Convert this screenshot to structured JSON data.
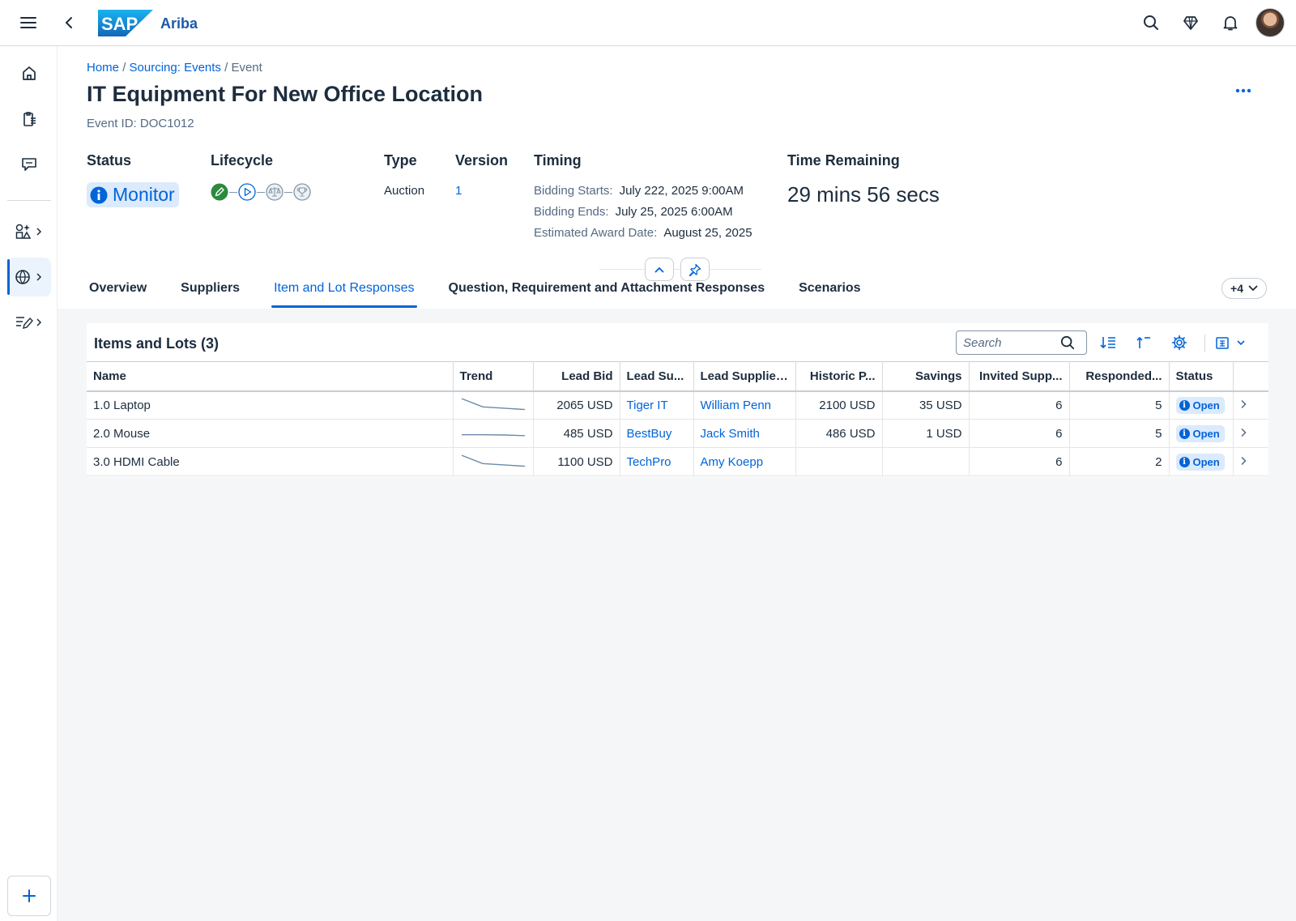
{
  "shell": {
    "logo_text": "SAP",
    "product": "Ariba",
    "brand_color": "#1b5aa6"
  },
  "breadcrumb": {
    "home": "Home",
    "sep1": "/",
    "events": "Sourcing: Events",
    "sep2": "/",
    "current": "Event"
  },
  "header": {
    "title": "IT Equipment For New Office Location",
    "event_id": "Event ID: DOC1012",
    "status_label": "Status",
    "status_value": "Monitor",
    "lifecycle_label": "Lifecycle",
    "type_label": "Type",
    "type_value": "Auction",
    "version_label": "Version",
    "version_value": "1",
    "timing_label": "Timing",
    "bidding_starts_label": "Bidding Starts:",
    "bidding_starts_value": "July 222, 2025 9:00AM",
    "bidding_ends_label": "Bidding Ends:",
    "bidding_ends_value": "July 25, 2025 6:00AM",
    "award_date_label": "Estimated Award Date:",
    "award_date_value": "August 25, 2025",
    "time_remaining_label": "Time Remaining",
    "time_remaining_value": "29 mins 56 secs"
  },
  "tabs": [
    {
      "label": "Overview"
    },
    {
      "label": "Suppliers"
    },
    {
      "label": "Item and Lot Responses",
      "active": true
    },
    {
      "label": "Question, Requirement and Attachment Responses"
    },
    {
      "label": "Scenarios"
    }
  ],
  "tab_overflow": "+4",
  "items_card": {
    "title": "Items and Lots (3)",
    "search_placeholder": "Search",
    "columns": [
      "Name",
      "Trend",
      "Lead Bid",
      "Lead Su...",
      "Lead Supplier...",
      "Historic P...",
      "Savings",
      "Invited Supp...",
      "Responded...",
      "Status"
    ],
    "rows": [
      {
        "name": "1.0  Laptop",
        "trend": [
          3,
          1.2,
          0.9,
          0.6
        ],
        "lead_bid": "2065 USD",
        "lead_supplier": "Tiger IT",
        "lead_supplier_contact": "William Penn",
        "historic_price": "2100 USD",
        "savings": "35 USD",
        "invited": "6",
        "responded": "5",
        "status": "Open"
      },
      {
        "name": "2.0 Mouse",
        "trend": [
          1.3,
          1.3,
          1.25,
          1.1
        ],
        "lead_bid": "485 USD",
        "lead_supplier": "BestBuy",
        "lead_supplier_contact": "Jack Smith",
        "historic_price": "486 USD",
        "savings": "1 USD",
        "invited": "6",
        "responded": "5",
        "status": "Open"
      },
      {
        "name": "3.0 HDMI Cable",
        "trend": [
          3,
          1.2,
          0.9,
          0.6
        ],
        "lead_bid": "1100 USD",
        "lead_supplier": "TechPro",
        "lead_supplier_contact": "Amy Koepp",
        "historic_price": "",
        "savings": "",
        "invited": "6",
        "responded": "2",
        "status": "Open"
      }
    ]
  },
  "colors": {
    "accent": "#0064d9",
    "status_bg": "#dbeafc",
    "lifecycle_done": "#2b8a3e",
    "text": "#1d2d3e",
    "muted": "#556b82"
  },
  "icons": {
    "shell": [
      "menu-icon",
      "back-icon",
      "search-icon",
      "diamond-icon",
      "bell-icon"
    ],
    "nav": [
      "home-icon",
      "clipboard-list-icon",
      "chat-feedback-icon",
      "shapes-icon",
      "globe-icon",
      "edit-list-icon",
      "plus-icon"
    ],
    "lifecycle": [
      "pencil-icon",
      "play-icon",
      "scale-icon",
      "trophy-icon"
    ]
  }
}
